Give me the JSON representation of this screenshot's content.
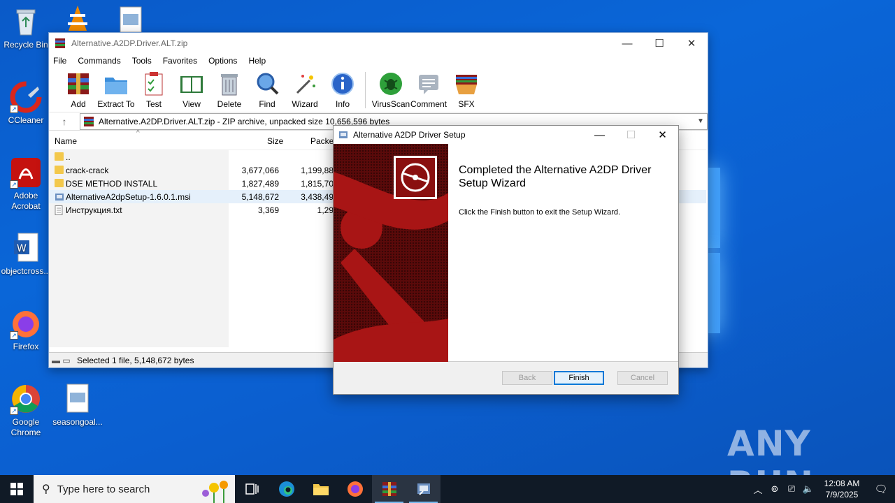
{
  "desktop": {
    "icons": [
      {
        "label": "Recycle Bin"
      },
      {
        "label": "CCleaner"
      },
      {
        "label": "Adobe Acrobat"
      },
      {
        "label": "objectcross..."
      },
      {
        "label": "Firefox"
      },
      {
        "label": "Google Chrome"
      },
      {
        "label": "seasongoal..."
      }
    ]
  },
  "winrar": {
    "title": "Alternative.A2DP.Driver.ALT.zip",
    "menu": [
      "File",
      "Commands",
      "Tools",
      "Favorites",
      "Options",
      "Help"
    ],
    "toolbar": [
      "Add",
      "Extract To",
      "Test",
      "View",
      "Delete",
      "Find",
      "Wizard",
      "Info",
      "VirusScan",
      "Comment",
      "SFX"
    ],
    "address": "Alternative.A2DP.Driver.ALT.zip - ZIP archive, unpacked size 10,656,596 bytes",
    "columns": {
      "name": "Name",
      "size": "Size",
      "packed": "Packed"
    },
    "rows": [
      {
        "name": "..",
        "size": "",
        "packed": "",
        "type": "folder"
      },
      {
        "name": "crack-crack",
        "size": "3,677,066",
        "packed": "1,199,88",
        "type": "folder"
      },
      {
        "name": "DSE METHOD INSTALL",
        "size": "1,827,489",
        "packed": "1,815,70",
        "type": "folder"
      },
      {
        "name": "AlternativeA2dpSetup-1.6.0.1.msi",
        "size": "5,148,672",
        "packed": "3,438,49",
        "type": "msi"
      },
      {
        "name": "Инструкция.txt",
        "size": "3,369",
        "packed": "1,29",
        "type": "txt"
      }
    ],
    "status": "Selected 1 file, 5,148,672 bytes"
  },
  "setup": {
    "title": "Alternative A2DP Driver Setup",
    "heading": "Completed the Alternative A2DP Driver Setup Wizard",
    "text": "Click the Finish button to exit the Setup Wizard.",
    "back": "Back",
    "finish": "Finish",
    "cancel": "Cancel"
  },
  "taskbar": {
    "search_placeholder": "Type here to search",
    "time": "12:08 AM",
    "date": "7/9/2025"
  },
  "watermark": "ANY RUN"
}
